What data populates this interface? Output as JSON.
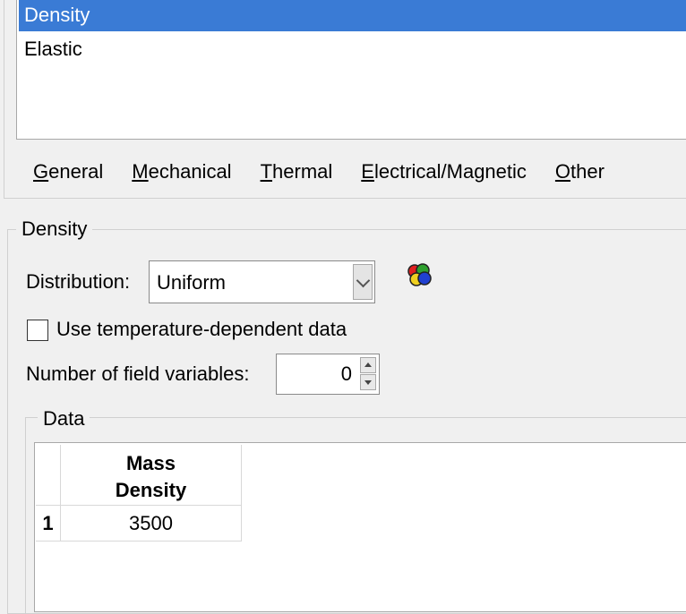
{
  "behaviors": {
    "items": [
      {
        "label": "Density",
        "selected": true
      },
      {
        "label": "Elastic",
        "selected": false
      }
    ]
  },
  "menu": {
    "general": {
      "mnemonic": "G",
      "rest": "eneral"
    },
    "mechanical": {
      "mnemonic": "M",
      "rest": "echanical"
    },
    "thermal": {
      "mnemonic": "T",
      "rest": "hermal"
    },
    "electrical": {
      "mnemonic": "E",
      "rest": "lectrical/Magnetic"
    },
    "other": {
      "mnemonic": "O",
      "rest": "ther"
    }
  },
  "density": {
    "group_title": "Density",
    "distribution_label": "Distribution:",
    "distribution_value": "Uniform",
    "temp_dependent_label": "Use temperature-dependent data",
    "temp_dependent_checked": false,
    "field_vars_label": "Number of field variables:",
    "field_vars_value": "0"
  },
  "data": {
    "group_title": "Data",
    "columns": [
      {
        "line1": "Mass",
        "line2": "Density"
      }
    ],
    "rows": [
      {
        "index": "1",
        "values": [
          "3500"
        ]
      }
    ]
  },
  "colors": {
    "selection": "#3a7bd5",
    "background": "#f0f0f0"
  },
  "icons": {
    "color_palette": "color-palette-icon"
  }
}
